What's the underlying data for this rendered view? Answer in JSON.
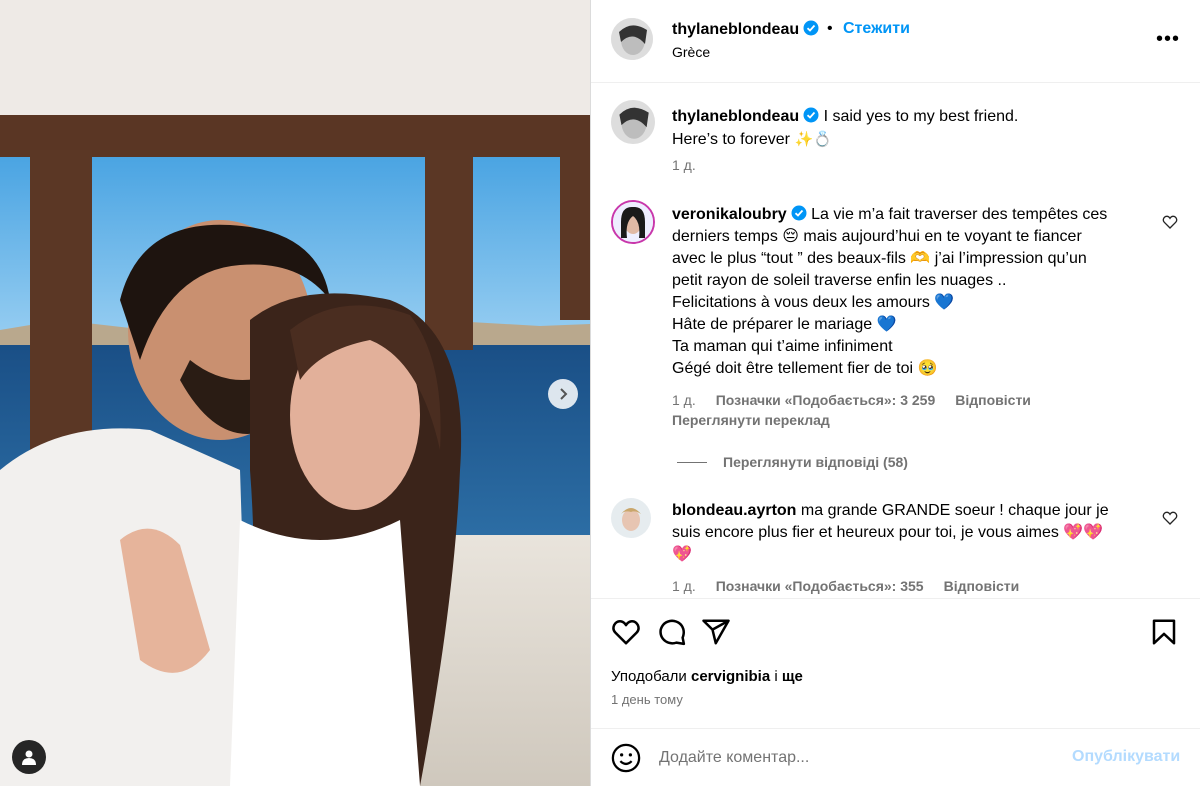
{
  "post": {
    "author": "thylaneblondeau",
    "follow_label": "Стежити",
    "separator": "•",
    "location": "Grèce",
    "more_label": "•••",
    "carousel": {
      "slides": 10,
      "active_slide": 1
    }
  },
  "caption": {
    "username": "thylaneblondeau",
    "line1": "I said yes to my best friend.",
    "line2": "Here’s to forever",
    "emojis": "✨💍",
    "age": "1 д."
  },
  "comments": [
    {
      "username": "veronikaloubry",
      "lines": [
        "La vie m’a fait traverser des tempêtes ces",
        "derniers temps 😔 mais aujourd’hui en te voyant te fiancer",
        "avec le plus “tout ” des beaux-fils 🫶 j’ai l’impression qu’un",
        "petit rayon de soleil traverse enfin les nuages ..",
        "Felicitations à vous deux les amours 💙",
        "Hâte de préparer le mariage 💙",
        "Ta maman qui t’aime infiniment",
        "Gégé doit être tellement fier de toi 🥹"
      ],
      "age": "1 д.",
      "likes": "Позначки «Подобається»: 3 259",
      "reply_label": "Відповісти",
      "translate_label": "Переглянути переклад",
      "view_replies": "Переглянути відповіді (58)"
    },
    {
      "username": "blondeau.ayrton",
      "lines": [
        "ma grande GRANDE soeur ! chaque jour je",
        "suis encore plus fier et heureux pour toi, je vous aimes 💖💖",
        "💖"
      ],
      "age": "1 д.",
      "likes": "Позначки «Подобається»: 355",
      "reply_label": "Відповісти"
    }
  ],
  "liked_by": {
    "prefix": "Уподобали",
    "user": "cervignibia",
    "joiner": "і",
    "suffix": "ще"
  },
  "date": "1 день тому",
  "composer": {
    "placeholder": "Додайте коментар...",
    "post_label": "Опублікувати"
  },
  "colors": {
    "accent": "#0095f6",
    "muted": "#737373",
    "post_disabled": "#b3dbff",
    "verified": "#0095f6"
  },
  "icons": [
    "heart-icon",
    "comment-icon",
    "share-icon",
    "bookmark-icon",
    "emoji-icon",
    "chevron-right-icon",
    "user-tag-icon",
    "more-icon",
    "verified-icon"
  ]
}
